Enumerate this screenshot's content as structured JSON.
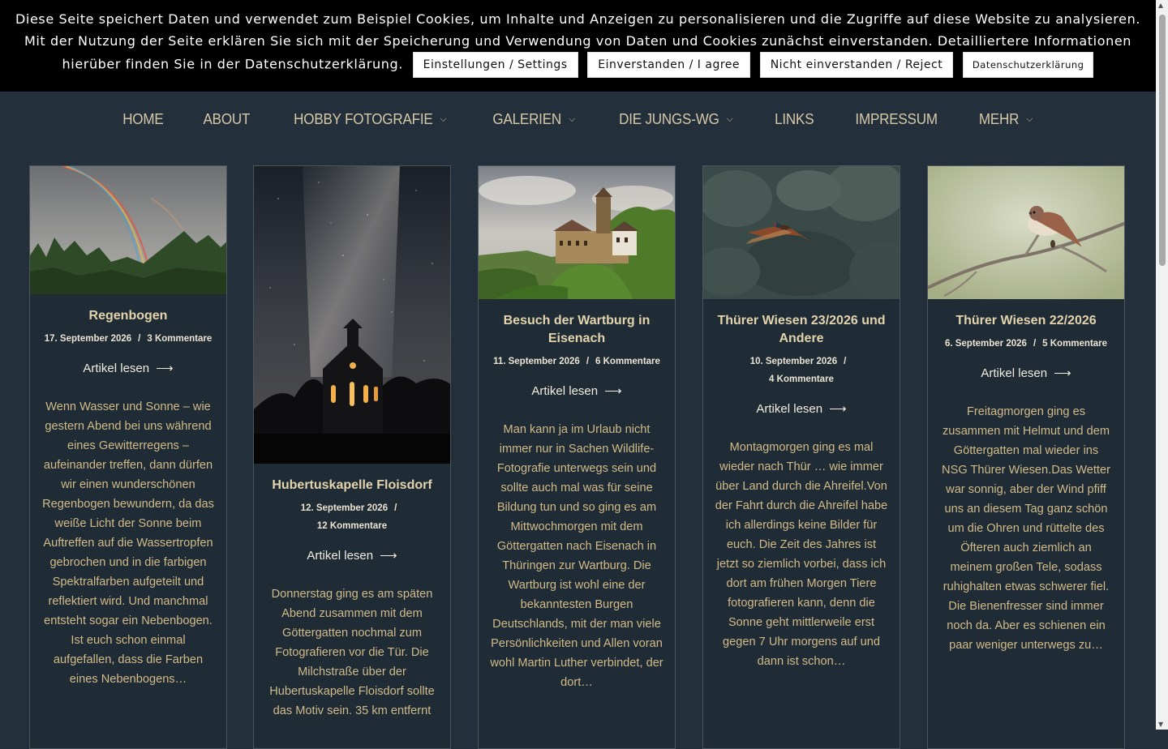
{
  "cookie_banner": {
    "text": "Diese Seite speichert Daten und verwendet zum Beispiel Cookies, um Inhalte und Anzeigen zu personalisieren und die Zugriffe auf diese Website zu analysieren. Mit der Nutzung der Seite erklären Sie sich mit der Speicherung und Verwendung von Daten und Cookies zunächst einverstanden. Detailliertere Informationen hierüber finden Sie in der Datenschutzerklärung.",
    "settings_label": "Einstellungen / Settings",
    "agree_label": "Einverstanden / I agree",
    "reject_label": "Nicht einverstanden / Reject",
    "privacy_label": "Datenschutzerklärung"
  },
  "nav": {
    "items": [
      {
        "label": "HOME",
        "has_dropdown": false
      },
      {
        "label": "ABOUT",
        "has_dropdown": false
      },
      {
        "label": "HOBBY FOTOGRAFIE",
        "has_dropdown": true
      },
      {
        "label": "GALERIEN",
        "has_dropdown": true
      },
      {
        "label": "DIE JUNGS-WG",
        "has_dropdown": true
      },
      {
        "label": "LINKS",
        "has_dropdown": false
      },
      {
        "label": "IMPRESSUM",
        "has_dropdown": false
      },
      {
        "label": "MEHR",
        "has_dropdown": true
      }
    ],
    "chevron_icon": "chevron-down-icon"
  },
  "posts": [
    {
      "title": "Regenbogen",
      "date": "17. September 2026",
      "comments": "3 Kommentare",
      "read_more": "Artikel lesen",
      "excerpt": "Wenn Wasser und Sonne – wie gestern Abend bei uns während eines Gewitterregens – aufeinander treffen, dann dürfen wir einen wunderschönen Regenbogen bewundern, da das weiße Licht der Sonne beim Auftreffen auf die Wassertropfen gebrochen und in die farbigen Spektralfarben aufgeteilt und reflektiert wird. Und manchmal entsteht sogar ein Nebenbogen. Ist euch schon einmal aufgefallen, dass die Farben eines Nebenbogens…"
    },
    {
      "title": "Hubertuskapelle Floisdorf",
      "date": "12. September 2026",
      "comments": "12 Kommentare",
      "read_more": "Artikel lesen",
      "excerpt": "Donnerstag ging es am späten Abend zusammen mit dem Göttergatten nochmal zum Fotografieren vor die Tür. Die Milchstraße über der Hubertuskapelle Floisdorf sollte das Motiv sein. 35 km entfernt"
    },
    {
      "title": "Besuch der Wartburg in Eisenach",
      "date": "11. September 2026",
      "comments": "6 Kommentare",
      "read_more": "Artikel lesen",
      "excerpt": "Man kann ja im Urlaub nicht immer nur in Sachen Wildlife-Fotografie unterwegs sein und sollte auch mal was für seine Bildung tun und so ging es am Mittwochmorgen mit dem Göttergatten nach Eisenach in Thüringen zur Wartburg. Die Wartburg ist wohl eine der bekanntesten Burgen Deutschlands, mit der man viele Persönlichkeiten und Allen voran wohl Martin Luther verbindet, der dort…"
    },
    {
      "title": "Thürer Wiesen 23/2026 und Andere",
      "date": "10. September 2026",
      "comments": "4 Kommentare",
      "read_more": "Artikel lesen",
      "excerpt": "Montagmorgen ging es mal wieder nach Thür … wie immer über Land durch die Ahreifel.Von der Fahrt durch die Ahreifel habe ich allerdings keine Bilder für euch. Die Zeit des Jahres ist jetzt so ziemlich vorbei, dass ich dort am frühen Morgen Tiere fotografieren kann, denn die Sonne geht mittlerweile erst gegen 7 Uhr morgens auf und dann ist schon…"
    },
    {
      "title": "Thürer Wiesen 22/2026",
      "date": "6. September 2026",
      "comments": "5 Kommentare",
      "read_more": "Artikel lesen",
      "excerpt": "Freitagmorgen ging es zusammen mit Helmut und dem Göttergatten mal wieder ins NSG Thürer Wiesen.Das Wetter war sonnig, aber der Wind pfiff uns an diesem Tag ganz schön um die Ohren und rüttelte des Öfteren auch ziemlich an meinem großen Tele, sodass ruhighalten etwas schwerer fiel. Die Bienenfresser sind immer noch da. Aber es schienen ein paar weniger unterwegs zu…"
    }
  ],
  "colors": {
    "page_bg": "#232f3a",
    "nav_text": "#d6c9a8",
    "title": "#e3d4ad",
    "excerpt": "#d1bb8a"
  }
}
